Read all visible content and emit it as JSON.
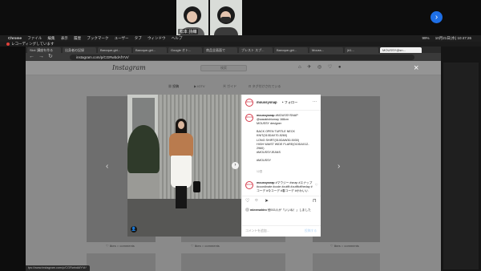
{
  "zoom": {
    "participants": [
      {
        "name": "松本 詩織"
      },
      {
        "name": ""
      }
    ]
  },
  "menubar": {
    "app": "Chrome",
    "items": [
      "ファイル",
      "編集",
      "表示",
      "履歴",
      "ブックマーク",
      "ユーザー",
      "タブ",
      "ウィンドウ",
      "ヘルプ"
    ],
    "battery": "99%",
    "clock": "10月21日(水) 10:47:26"
  },
  "recording_banner": "レコーディングしています",
  "tabs": [
    {
      "label": "Slot: 講座を作る"
    },
    {
      "label": "出身者の記録"
    },
    {
      "label": "Baroque-girl..."
    },
    {
      "label": "Baroque-girl..."
    },
    {
      "label": "Google オト..."
    },
    {
      "label": "商品全画面で"
    },
    {
      "label": "ブレスト スプ..."
    },
    {
      "label": "Baroque-girl..."
    },
    {
      "label": "Mouss..."
    },
    {
      "label": "|#1..."
    },
    {
      "label": "MOUSSY@sn..."
    }
  ],
  "address": {
    "url": "instagram.com/p/CGRwbdAfYVr/"
  },
  "instagram": {
    "logo": "Instagram",
    "search_placeholder": "検索",
    "nav_icons": "⌂ ✈ ◎ ♡ ●",
    "profile_tabs": [
      "▦ 投稿",
      "▶ IGTV",
      "▣ ガイド",
      "⊡ タグ付けされている"
    ],
    "grid_labels": [
      "♡ likes   ○ comments",
      "♡ likes   ○ comments",
      "♡ likes   ○ comments"
    ]
  },
  "modal": {
    "close": "×",
    "prev": "‹",
    "next": "›",
    "photo_next": "›",
    "user_tag": "👤",
    "avatar_text": "MOUSSY",
    "username": "moussysnap",
    "follow_label": "• フォロー",
    "more": "···",
    "caption_username": "moussysnap",
    "caption_lines": [
      "#MOUSSYSNAP",
      "@sasakishiomay 168cm",
      "MOUSSY designer",
      "",
      "BACK OPEN TURTLE NECK",
      "KNIT(010DAX70-5260)",
      "LONG SHIRT(010DAW30-5030)",
      "HIGH WAIST WIDE FLARE(010DAX12-",
      "2960)",
      "#MOUSSYJEANS",
      "",
      "#MOUSSY"
    ],
    "caption_time": "12週",
    "comment_username": "moussysnap",
    "comment_text": "#マウジー #snap #スナップ #coordinate #code #outfit #outfitoftheday #コーデ #今コーデ #春コーデ #かわいい",
    "comment_time": "12週",
    "liked_by_name": "mieemahiro",
    "liked_by_rest": "他915人が「いいね！」しました",
    "comment_placeholder": "コメントを追加...",
    "post_button": "投稿する"
  },
  "status_url": "tps://www.instagram.com/p/CGRwbdAfYVr/",
  "zoom_button_icon": "›"
}
